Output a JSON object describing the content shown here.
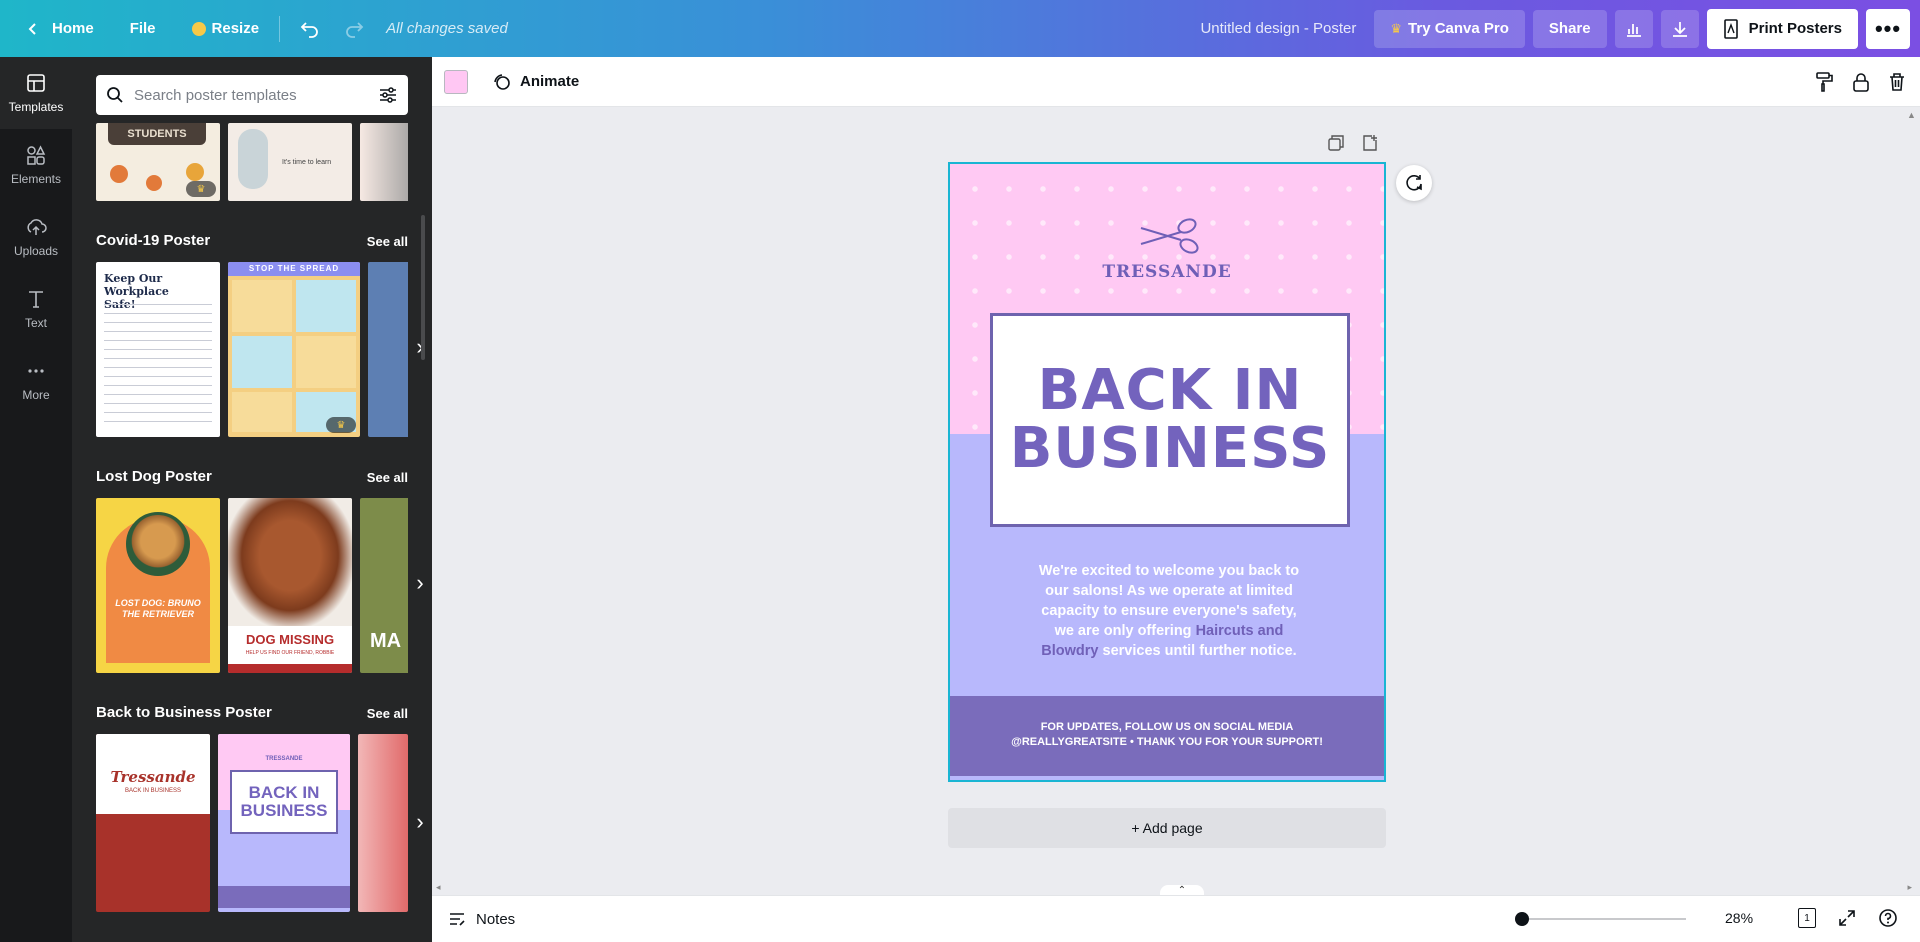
{
  "topbar": {
    "home_label": "Home",
    "file_label": "File",
    "resize_label": "Resize",
    "saved_status": "All changes saved",
    "design_title": "Untitled design - Poster",
    "try_pro_label": "Try Canva Pro",
    "share_label": "Share",
    "print_label": "Print Posters",
    "more_label": "•••"
  },
  "rail": {
    "items": [
      {
        "label": "Templates",
        "icon": "templates-icon"
      },
      {
        "label": "Elements",
        "icon": "elements-icon"
      },
      {
        "label": "Uploads",
        "icon": "uploads-icon"
      },
      {
        "label": "Text",
        "icon": "text-icon"
      },
      {
        "label": "More",
        "icon": "more-icon"
      }
    ]
  },
  "panel": {
    "search_placeholder": "Search poster templates",
    "top_row": {
      "t1": "STUDENTS",
      "t2": "It's time to learn"
    },
    "sections": [
      {
        "title": "Covid-19 Poster",
        "see_all": "See all",
        "t1_title": "Keep Our Workplace Safe!",
        "t2_title": "STOP THE SPREAD"
      },
      {
        "title": "Lost Dog Poster",
        "see_all": "See all",
        "t1_title": "LOST DOG: BRUNO THE RETRIEVER",
        "t2_title": "DOG MISSING",
        "t2_sub": "HELP US FIND OUR FRIEND, ROBBIE",
        "t3_text": "MA"
      },
      {
        "title": "Back to Business Poster",
        "see_all": "See all",
        "t1_title": "Tressande",
        "t1_sub": "BACK IN BUSINESS",
        "t2_brand": "TRESSANDE",
        "t2_title": "BACK IN BUSINESS"
      }
    ]
  },
  "toolbar": {
    "animate_label": "Animate",
    "swatch_color": "#ffc7f3"
  },
  "poster": {
    "brand": "TRESSANDE",
    "headline_line1": "BACK IN",
    "headline_line2": "BUSINESS",
    "body_l1": "We're excited to welcome you back to",
    "body_l2": "our salons! As we operate at limited",
    "body_l3": "capacity to ensure everyone's safety,",
    "body_l4a": "we are only offering",
    "body_l4b": "Haircuts and",
    "body_l5a": "Blowdry",
    "body_l5b": "services until further notice.",
    "band_l1": "FOR UPDATES, FOLLOW US ON SOCIAL MEDIA",
    "band_l2": "@REALLYGREATSITE • THANK YOU FOR YOUR SUPPORT!",
    "colors": {
      "pink": "#ffc9f3",
      "lavender": "#b8b8fc",
      "purple": "#7a6cbb"
    }
  },
  "canvas": {
    "add_page_label": "+ Add page"
  },
  "bottombar": {
    "notes_label": "Notes",
    "zoom_value": "28%",
    "page_count": "1"
  }
}
